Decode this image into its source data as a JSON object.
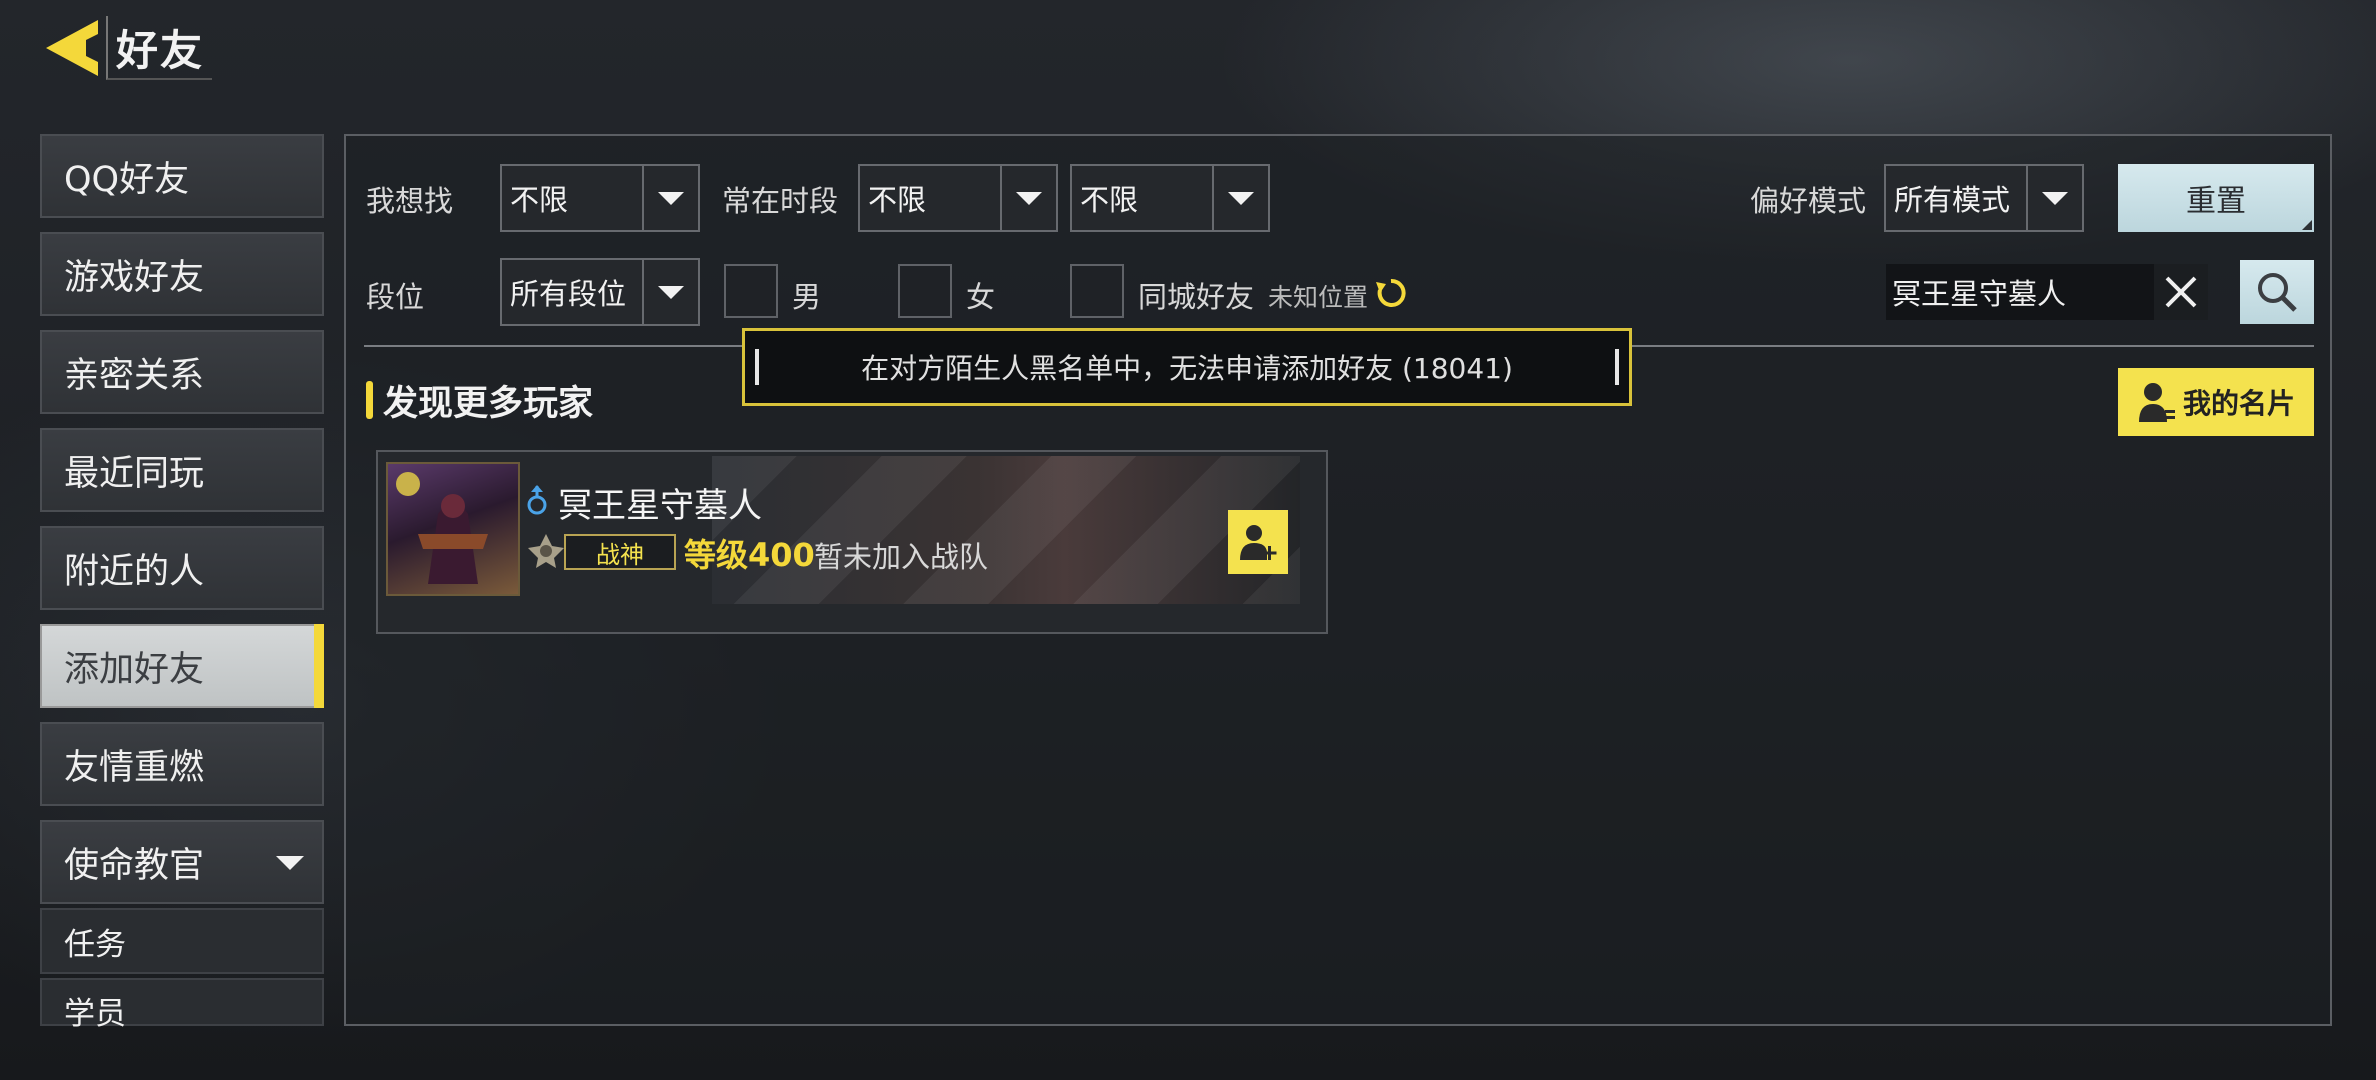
{
  "header": {
    "title": "好友"
  },
  "sidebar": {
    "items": [
      {
        "label": "QQ好友"
      },
      {
        "label": "游戏好友"
      },
      {
        "label": "亲密关系"
      },
      {
        "label": "最近同玩"
      },
      {
        "label": "附近的人"
      },
      {
        "label": "添加好友",
        "active": true
      },
      {
        "label": "友情重燃"
      },
      {
        "label": "使命教官",
        "expanded": true
      }
    ],
    "sub_items": [
      {
        "label": "任务"
      },
      {
        "label": "学员"
      }
    ]
  },
  "filters": {
    "want_label": "我想找",
    "want_value": "不限",
    "time_label": "常在时段",
    "time_value_1": "不限",
    "time_value_2": "不限",
    "mode_label": "偏好模式",
    "mode_value": "所有模式",
    "rank_label": "段位",
    "rank_value": "所有段位",
    "male_label": "男",
    "female_label": "女",
    "same_city_label": "同城好友",
    "location_text": "未知位置",
    "reset_label": "重置"
  },
  "search": {
    "value": "冥王星守墓人"
  },
  "toast": {
    "message": "在对方陌生人黑名单中，无法申请添加好友 (18041)"
  },
  "section": {
    "title": "发现更多玩家",
    "my_card_label": "我的名片"
  },
  "player": {
    "name": "冥王星守墓人",
    "gender": "male",
    "rank": "战神",
    "level": "等级400",
    "team": "暂未加入战队"
  },
  "colors": {
    "accent_yellow": "#f4e24e",
    "button_light_blue": "#cfe4ea",
    "panel_border": "#5b5e63"
  }
}
